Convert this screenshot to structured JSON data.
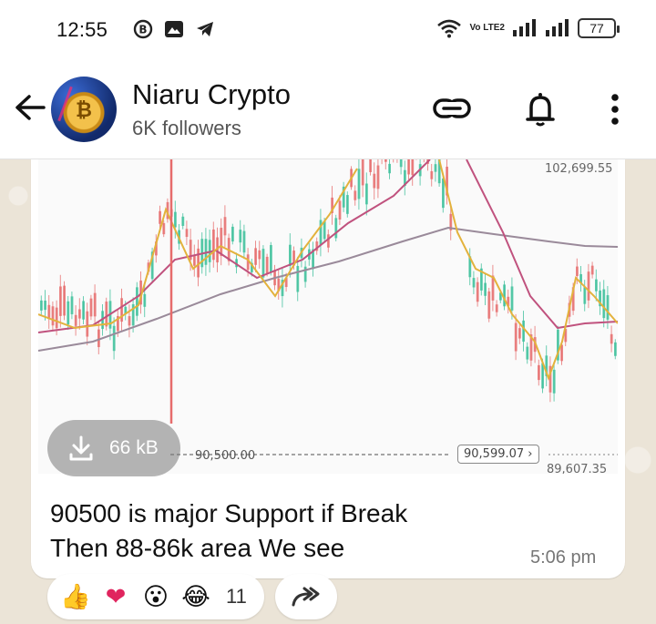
{
  "status_bar": {
    "time": "12:55",
    "left_icons": [
      "b-circle-icon",
      "gallery-icon",
      "telegram-icon"
    ],
    "volte_label": "Vo LTE2",
    "battery": "77"
  },
  "header": {
    "channel_name": "Niaru Crypto",
    "followers": "6K followers",
    "icons": [
      "back-arrow-icon",
      "link-icon",
      "bell-icon",
      "more-vert-icon"
    ]
  },
  "message": {
    "chart_labels": {
      "top_price": "102,699.55",
      "support_line": "90,500.00",
      "current_price": "90,599.07",
      "low_price": "89,607.35"
    },
    "file_size": "66 kB",
    "caption_line1": "90500 is major Support if Break",
    "caption_line2": "Then 88-86k area We see",
    "time": "5:06 pm"
  },
  "reactions": {
    "emojis": [
      "👍",
      "❤",
      "😮",
      "😂"
    ],
    "count": "11"
  },
  "colors": {
    "bullish": "#3bbf9a",
    "bearish": "#e66b6b",
    "ma_short": "#e3b23c",
    "ma_mid": "#c0527e",
    "ma_long": "#9a8a9a"
  }
}
